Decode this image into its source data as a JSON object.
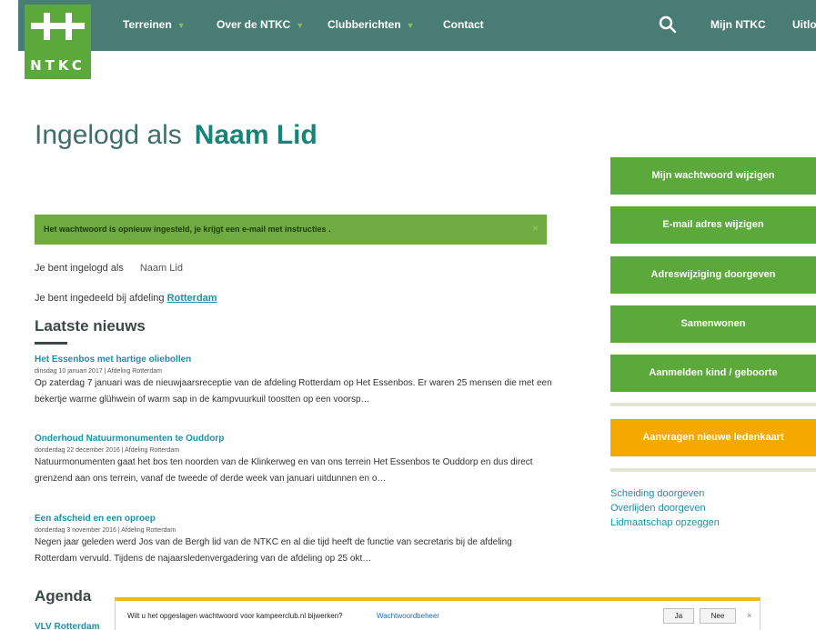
{
  "header": {
    "logo_text": "NTKC",
    "nav": [
      {
        "label": "Terreinen",
        "has_dropdown": true
      },
      {
        "label": "Over de NTKC",
        "has_dropdown": true
      },
      {
        "label": "Clubberichten",
        "has_dropdown": true
      },
      {
        "label": "Contact",
        "has_dropdown": false
      }
    ],
    "search_icon": "search-icon",
    "mijn_ntkc": "Mijn NTKC",
    "logout": "Uitlo"
  },
  "page": {
    "title_prefix": "Ingelogd als",
    "title_name": "Naam Lid"
  },
  "alert": {
    "message": "Het wachtwoord is opnieuw ingesteld, je krijgt een e-mail met instructies .",
    "close": "×"
  },
  "info": {
    "logged_in_label": "Je bent ingelogd als",
    "logged_in_value": "Naam Lid",
    "department_label": "Je bent ingedeeld bij afdeling",
    "department_link": "Rotterdam"
  },
  "news": {
    "heading": "Laatste nieuws",
    "items": [
      {
        "title": "Het Essenbos met hartige oliebollen",
        "meta": "dinsdag 10 januari 2017 | Afdeling Rotterdam",
        "excerpt": "Op zaterdag 7 januari was de nieuwjaarsreceptie van de afdeling Rotterdam op Het Essenbos. Er waren 25 mensen die met een bekertje warme glühwein of warm sap in de kampvuurkuil toostten op een voorsp…"
      },
      {
        "title": "Onderhoud Natuurmonumenten te Ouddorp",
        "meta": "donderdag 22 december 2016 | Afdeling Rotterdam",
        "excerpt": "Natuurmonumenten gaat het bos ten noorden van de Klinkerweg en van ons terrein Het Essenbos te Ouddorp en dus direct grenzend aan ons terrein, vanaf de tweede of derde week van januari uitdunnen en o…"
      },
      {
        "title": "Een afscheid en een oproep",
        "meta": "donderdag 3 november 2016 | Afdeling Rotterdam",
        "excerpt": "Negen jaar geleden werd Jos van de Bergh lid van de NTKC en al die tijd heeft de functie van secretaris bij de afdeling Rotterdam vervuld. Tijdens de najaarsledenvergadering van de afdeling op 25 okt…"
      }
    ]
  },
  "agenda": {
    "heading": "Agenda",
    "first_item": "VLV Rotterdam"
  },
  "sidebar": {
    "buttons": [
      {
        "label": "Mijn wachtwoord wijzigen"
      },
      {
        "label": "E-mail adres wijzigen"
      },
      {
        "label": "Adreswijziging doorgeven"
      },
      {
        "label": "Samenwonen"
      },
      {
        "label": "Aanmelden kind / geboorte"
      }
    ],
    "highlight_button": "Aanvragen nieuwe ledenkaart",
    "links": [
      {
        "label": "Scheiding doorgeven"
      },
      {
        "label": "Overlijden doorgeven"
      },
      {
        "label": "Lidmaatschap opzeggen"
      }
    ]
  },
  "password_bar": {
    "question": "Wilt u het opgeslagen wachtwoord voor kampeerclub.nl bijwerken?",
    "manager_link": "Wachtwoordbeheer",
    "yes": "Ja",
    "no": "Nee",
    "close": "×"
  },
  "colors": {
    "topbar": "#4a7c76",
    "green": "#5ba83b",
    "orange": "#f5a800",
    "link": "#1f8fa7"
  }
}
